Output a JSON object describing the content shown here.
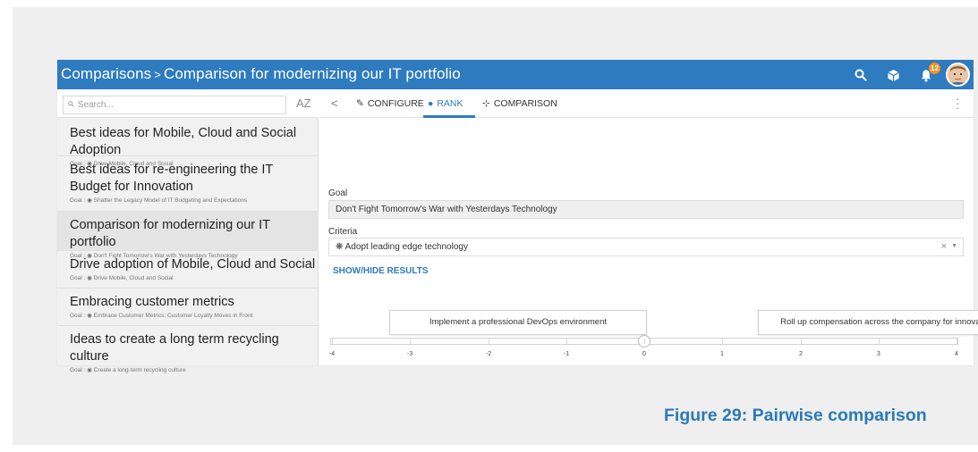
{
  "breadcrumb": {
    "root": "Comparisons",
    "separator": ">",
    "current": "Comparison for modernizing our IT portfolio"
  },
  "topbar": {
    "notification_count": "12",
    "icons": [
      "search-icon",
      "cube-icon",
      "bell-icon",
      "avatar"
    ]
  },
  "sidebar": {
    "search_placeholder": "Search...",
    "sort_label": "AZ",
    "items": [
      {
        "title": "Best ideas for Mobile, Cloud and Social Adoption",
        "goal_prefix": "Goal :",
        "goal": "Drive Mobile, Cloud and Social",
        "selected": false
      },
      {
        "title": "Best ideas for re-engineering the IT Budget for Innovation",
        "goal_prefix": "Goal :",
        "goal": "Shatter the Legacy Model of IT Budgeting and Expectations",
        "selected": false
      },
      {
        "title": "Comparison for modernizing our IT portfolio",
        "goal_prefix": "Goal :",
        "goal": "Don't Fight Tomorrow's War with Yesterdays Technology",
        "selected": true
      },
      {
        "title": "Drive adoption of Mobile, Cloud and Social",
        "goal_prefix": "Goal :",
        "goal": "Drive Mobile, Cloud and Social",
        "selected": false
      },
      {
        "title": "Embracing customer metrics",
        "goal_prefix": "Goal :",
        "goal": "Embrace Customer Metrics: Customer Loyalty Moves in Front",
        "selected": false
      },
      {
        "title": "Ideas to create a long term recycling culture",
        "goal_prefix": "Goal :",
        "goal": "Create a long-term recycling culture",
        "selected": false
      }
    ]
  },
  "tabs": {
    "back": "<",
    "configure": "CONFIGURE",
    "rank": "RANK",
    "comparison": "COMPARISON",
    "active": "RANK"
  },
  "form": {
    "goal_label": "Goal",
    "goal_value": "Don't Fight Tomorrow's War with Yesterdays Technology",
    "criteria_label": "Criteria",
    "criteria_value": "Adopt leading edge technology",
    "clear": "×",
    "show_hide": "SHOW/HIDE RESULTS"
  },
  "ranking": {
    "left_option": "Implement a professional DevOps environment",
    "right_option": "Roll up compensation across the company for innovation",
    "scale": [
      "-4",
      "-3",
      "-2",
      "-1",
      "0",
      "1",
      "2",
      "3",
      "4"
    ],
    "slider_value": 0
  },
  "caption": "Figure 29: Pairwise comparison",
  "colors": {
    "header": "#2e7bc0",
    "accent": "#2e7bc0",
    "badge": "#f5911e",
    "caption": "#2a7ab8"
  }
}
